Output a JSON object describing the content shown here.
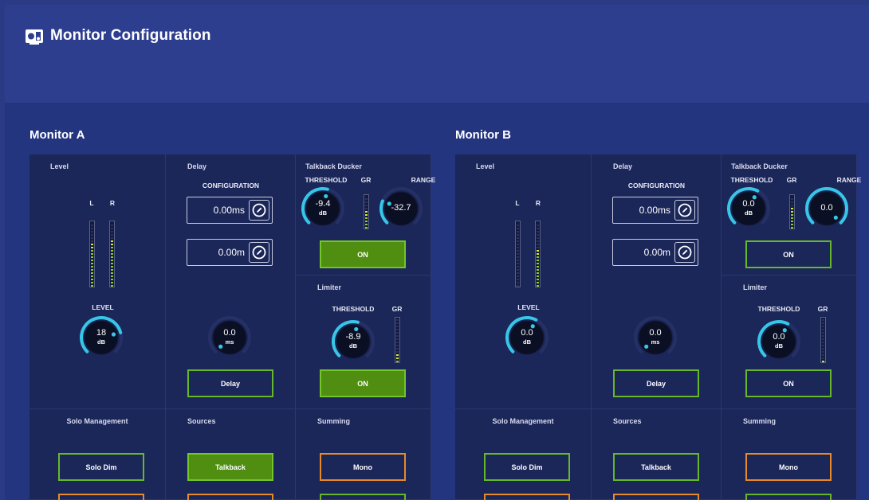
{
  "app": {
    "title": "Monitor Configuration",
    "icon": "speaker-monitor-icon"
  },
  "monitors": [
    {
      "name": "Monitor A",
      "level": {
        "label": "Level",
        "l_label": "L",
        "r_label": "R",
        "l_meter": 0.72,
        "r_meter": 0.76,
        "knob_label": "LEVEL",
        "value": "18",
        "unit": "dB",
        "knob_fraction": 0.78
      },
      "delay": {
        "label": "Delay",
        "config_label": "CONFIGURATION",
        "time_value": "0.00ms",
        "distance_value": "0.00m",
        "value": "0.0",
        "unit": "ms",
        "knob_fraction": 0.0,
        "button_label": "Delay",
        "button_active": false
      },
      "ducker": {
        "label": "Talkback Ducker",
        "threshold_label": "THRESHOLD",
        "gr_label": "GR",
        "range_label": "RANGE",
        "threshold_value": "-9.4",
        "threshold_unit": "dB",
        "threshold_fraction": 0.55,
        "range_value": "-32.7",
        "range_fraction": 0.25,
        "gr_meter": 0.62,
        "button_label": "ON",
        "button_active": true
      },
      "limiter": {
        "label": "Limiter",
        "threshold_label": "THRESHOLD",
        "gr_label": "GR",
        "threshold_value": "-8.9",
        "threshold_unit": "dB",
        "threshold_fraction": 0.55,
        "gr_meter": 0.2,
        "button_label": "ON",
        "button_active": true
      },
      "solo": {
        "label": "Solo Management",
        "button_label": "Solo Dim",
        "button_active": false
      },
      "sources": {
        "label": "Sources",
        "button_label": "Talkback",
        "button_active": true
      },
      "summing": {
        "label": "Summing",
        "button_label": "Mono"
      }
    },
    {
      "name": "Monitor B",
      "level": {
        "label": "Level",
        "l_label": "L",
        "r_label": "R",
        "l_meter": 0.0,
        "r_meter": 0.6,
        "knob_label": "LEVEL",
        "value": "0.0",
        "unit": "dB",
        "knob_fraction": 0.6
      },
      "delay": {
        "label": "Delay",
        "config_label": "CONFIGURATION",
        "time_value": "0.00ms",
        "distance_value": "0.00m",
        "value": "0.0",
        "unit": "ms",
        "knob_fraction": 0.0,
        "button_label": "Delay",
        "button_active": false
      },
      "ducker": {
        "label": "Talkback Ducker",
        "threshold_label": "THRESHOLD",
        "gr_label": "GR",
        "range_label": "RANGE",
        "threshold_value": "0.0",
        "threshold_unit": "dB",
        "threshold_fraction": 0.6,
        "range_value": "0.0",
        "range_fraction": 1.0,
        "gr_meter": 0.72,
        "button_label": "ON",
        "button_active": false
      },
      "limiter": {
        "label": "Limiter",
        "threshold_label": "THRESHOLD",
        "gr_label": "GR",
        "threshold_value": "0.0",
        "threshold_unit": "dB",
        "threshold_fraction": 0.6,
        "gr_meter": 0.04,
        "button_label": "ON",
        "button_active": false
      },
      "solo": {
        "label": "Solo Management",
        "button_label": "Solo Dim",
        "button_active": false
      },
      "sources": {
        "label": "Sources",
        "button_label": "Talkback",
        "button_active": false
      },
      "summing": {
        "label": "Summing",
        "button_label": "Mono"
      }
    }
  ],
  "colors": {
    "accent": "#38c6e6",
    "active_green": "#4f8e10",
    "green_border": "#66b82a",
    "orange_border": "#e8892a",
    "meter_green": "#8ecb2a",
    "meter_yellow": "#d8e830"
  }
}
